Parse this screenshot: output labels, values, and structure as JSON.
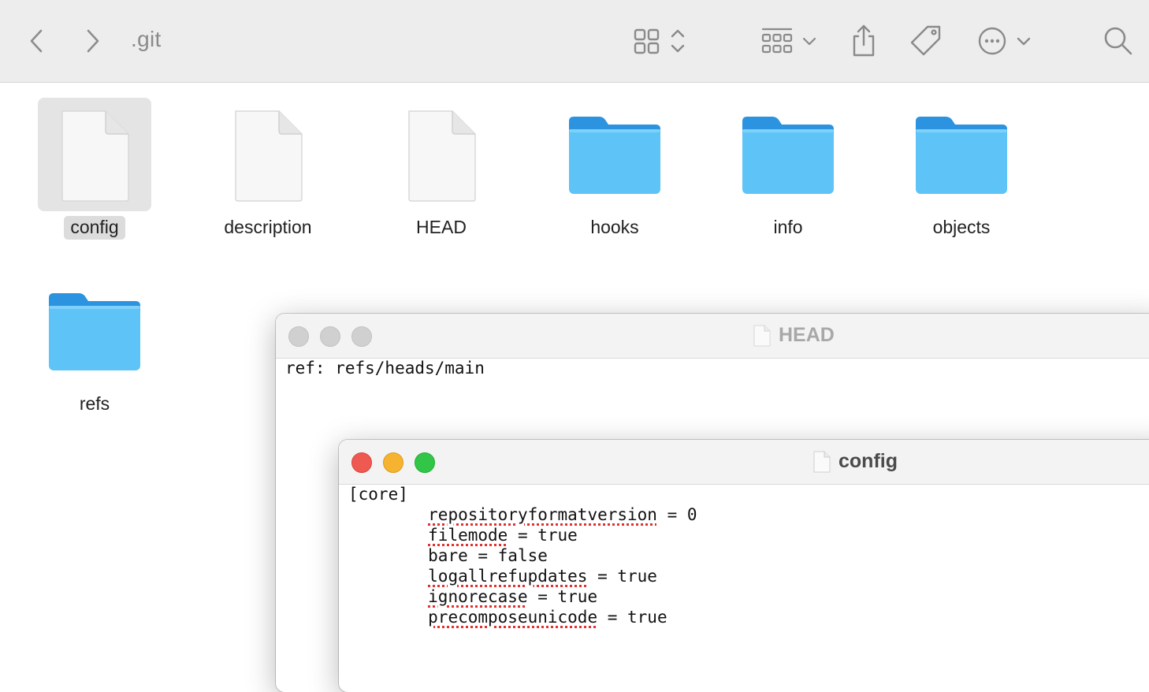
{
  "toolbar": {
    "title": ".git",
    "back_icon": "chevron-left-icon",
    "forward_icon": "chevron-right-icon",
    "view_icon": "grid-view-icon",
    "group_icon": "group-icon",
    "share_icon": "share-icon",
    "tag_icon": "tag-icon",
    "more_icon": "ellipsis-circle-icon",
    "search_icon": "search-icon"
  },
  "files": [
    {
      "name": "config",
      "kind": "document",
      "selected": true
    },
    {
      "name": "description",
      "kind": "document",
      "selected": false
    },
    {
      "name": "HEAD",
      "kind": "document",
      "selected": false
    },
    {
      "name": "hooks",
      "kind": "folder",
      "selected": false
    },
    {
      "name": "info",
      "kind": "folder",
      "selected": false
    },
    {
      "name": "objects",
      "kind": "folder",
      "selected": false
    },
    {
      "name": "refs",
      "kind": "folder",
      "selected": false
    }
  ],
  "head_window": {
    "title": "HEAD",
    "content": "ref: refs/heads/main"
  },
  "config_window": {
    "title": "config",
    "lines": [
      {
        "indent": false,
        "word": "[core]",
        "rest": "",
        "misspelled": false
      },
      {
        "indent": true,
        "word": "repositoryformatversion",
        "rest": " = 0",
        "misspelled": true
      },
      {
        "indent": true,
        "word": "filemode",
        "rest": " = true",
        "misspelled": true
      },
      {
        "indent": true,
        "word": "bare",
        "rest": " = false",
        "misspelled": false
      },
      {
        "indent": true,
        "word": "logallrefupdates",
        "rest": " = true",
        "misspelled": true
      },
      {
        "indent": true,
        "word": "ignorecase",
        "rest": " = true",
        "misspelled": true
      },
      {
        "indent": true,
        "word": "precomposeunicode",
        "rest": " = true",
        "misspelled": true
      }
    ]
  },
  "colors": {
    "folder_front": "#5ec3f7",
    "folder_back": "#2b93df",
    "close": "#ee5a52",
    "minimize": "#f5b330",
    "zoom": "#32c648",
    "inactive_light": "#d0d0d0",
    "spellcheck": "#e03030"
  }
}
